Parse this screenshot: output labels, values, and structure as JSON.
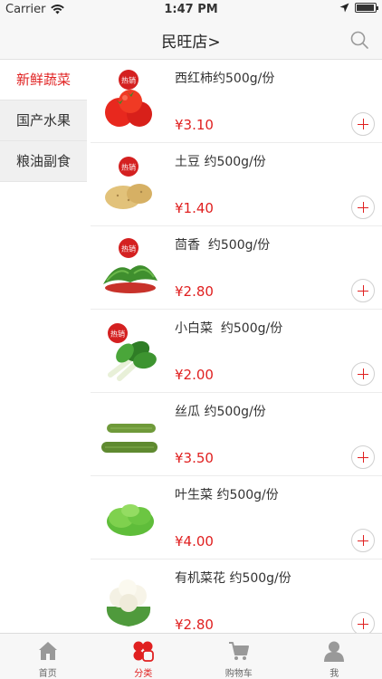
{
  "status_bar": {
    "carrier": "Carrier",
    "time": "1:47 PM"
  },
  "nav": {
    "title": "民旺店>"
  },
  "categories": [
    {
      "label": "新鲜蔬菜",
      "active": true
    },
    {
      "label": "国产水果",
      "active": false
    },
    {
      "label": "粮油副食",
      "active": false
    }
  ],
  "hot_badge": "热销",
  "products": [
    {
      "name": "西红柿约500g/份",
      "price": "¥3.10",
      "hot": true,
      "image": "tomato-image"
    },
    {
      "name": "土豆 约500g/份",
      "price": "¥1.40",
      "hot": true,
      "image": "potato-image"
    },
    {
      "name": "茴香  约500g/份",
      "price": "¥2.80",
      "hot": true,
      "image": "fennel-image"
    },
    {
      "name": "小白菜  约500g/份",
      "price": "¥2.00",
      "hot": true,
      "image": "bok-choy-image"
    },
    {
      "name": "丝瓜 约500g/份",
      "price": "¥3.50",
      "hot": false,
      "image": "loofah-image"
    },
    {
      "name": "叶生菜 约500g/份",
      "price": "¥4.00",
      "hot": false,
      "image": "lettuce-image"
    },
    {
      "name": "有机菜花 约500g/份",
      "price": "¥2.80",
      "hot": false,
      "image": "cauliflower-image"
    }
  ],
  "tabs": [
    {
      "label": "首页",
      "icon": "home-icon",
      "active": false
    },
    {
      "label": "分类",
      "icon": "category-icon",
      "active": true
    },
    {
      "label": "购物车",
      "icon": "cart-icon",
      "active": false
    },
    {
      "label": "我",
      "icon": "profile-icon",
      "active": false
    }
  ],
  "colors": {
    "accent": "#e02020",
    "sidebar_bg": "#f0f0f0",
    "bar_bg": "#f7f7f7"
  }
}
